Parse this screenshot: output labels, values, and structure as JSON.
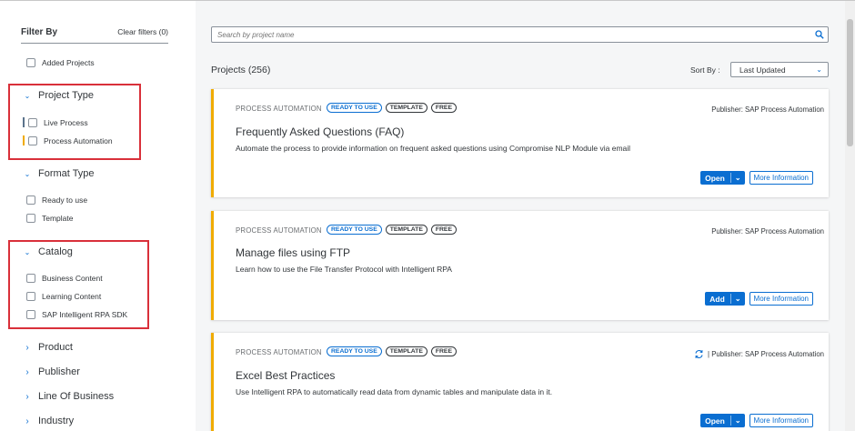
{
  "sidebar": {
    "title": "Filter By",
    "clear_filters": "Clear filters (0)",
    "added_projects": "Added Projects",
    "project_type": {
      "label": "Project Type",
      "items": [
        {
          "label": "Live Process",
          "color": "#5b738b"
        },
        {
          "label": "Process Automation",
          "color": "#f0ab00"
        }
      ]
    },
    "format_type": {
      "label": "Format Type",
      "items": [
        {
          "label": "Ready to use"
        },
        {
          "label": "Template"
        }
      ]
    },
    "catalog": {
      "label": "Catalog",
      "items": [
        {
          "label": "Business Content"
        },
        {
          "label": "Learning Content"
        },
        {
          "label": "SAP Intelligent RPA SDK"
        }
      ]
    },
    "collapsed_groups": [
      "Product",
      "Publisher",
      "Line Of Business",
      "Industry"
    ]
  },
  "search": {
    "placeholder": "Search by project name"
  },
  "projects": {
    "title": "Projects (256)"
  },
  "sort": {
    "label": "Sort By :",
    "selected": "Last Updated"
  },
  "cards": [
    {
      "category": "PROCESS AUTOMATION",
      "badges": [
        "READY TO USE",
        "TEMPLATE",
        "FREE"
      ],
      "publisher": "Publisher: SAP Process Automation",
      "title": "Frequently Asked Questions (FAQ)",
      "description": "Automate the process to provide information on frequent asked questions using Compromise NLP Module via email",
      "primary_action": "Open",
      "secondary_action": "More Information"
    },
    {
      "category": "PROCESS AUTOMATION",
      "badges": [
        "READY TO USE",
        "TEMPLATE",
        "FREE"
      ],
      "publisher": "Publisher: SAP Process Automation",
      "title": "Manage files using FTP",
      "description": "Learn how to use the File Transfer Protocol with Intelligent RPA",
      "primary_action": "Add",
      "secondary_action": "More Information"
    },
    {
      "category": "PROCESS AUTOMATION",
      "badges": [
        "READY TO USE",
        "TEMPLATE",
        "FREE"
      ],
      "publisher": "| Publisher: SAP Process Automation",
      "title": "Excel Best Practices",
      "description": "Use Intelligent RPA to automatically read data from dynamic tables and manipulate data in it.",
      "primary_action": "Open",
      "secondary_action": "More Information"
    }
  ],
  "colors": {
    "accent": "#0a6ed1",
    "card_stripe": "#f0ab00",
    "highlight": "#d9303a"
  },
  "icons": {
    "search": "search-icon",
    "refresh": "refresh-icon",
    "expand": "chevron-down-icon",
    "collapse": "chevron-right-icon"
  }
}
